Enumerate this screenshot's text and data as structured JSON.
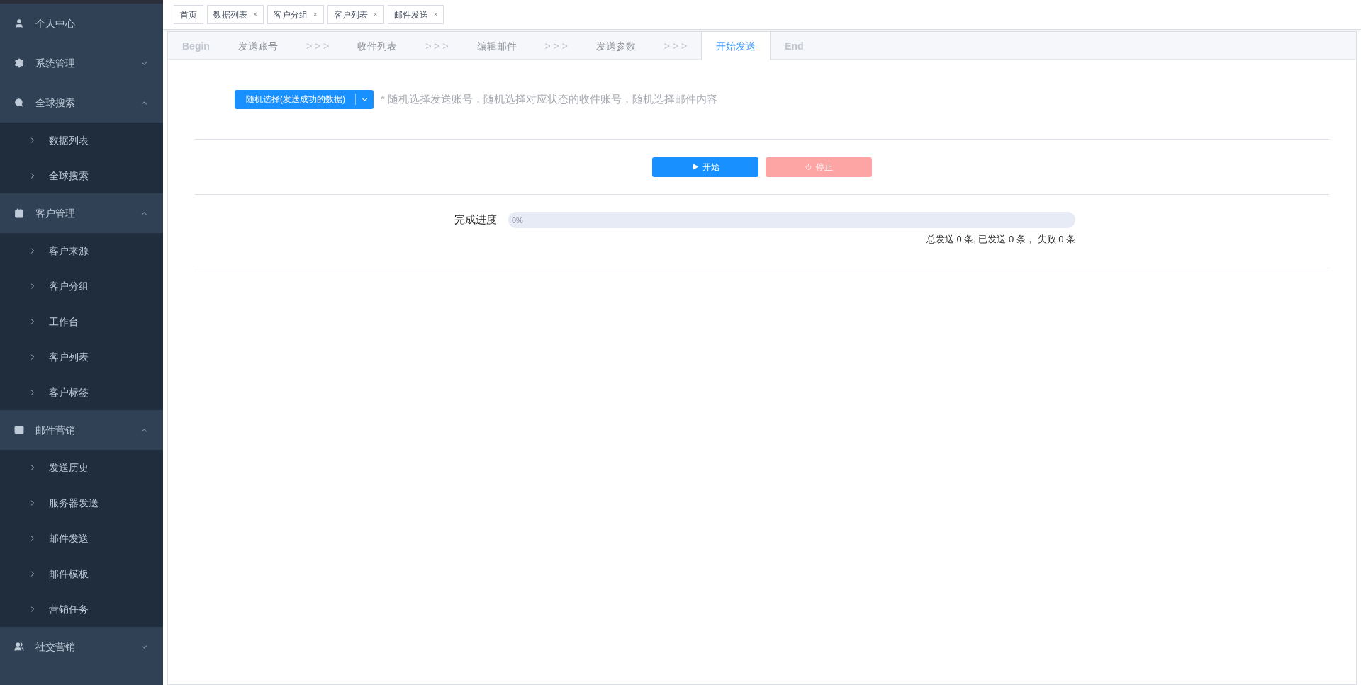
{
  "sidebar": {
    "items": [
      {
        "label": "个人中心",
        "has_children": false
      },
      {
        "label": "系统管理",
        "has_children": true,
        "expanded": false
      },
      {
        "label": "全球搜索",
        "has_children": true,
        "expanded": true,
        "children": [
          {
            "label": "数据列表"
          },
          {
            "label": "全球搜索"
          }
        ]
      },
      {
        "label": "客户管理",
        "has_children": true,
        "expanded": true,
        "children": [
          {
            "label": "客户来源"
          },
          {
            "label": "客户分组"
          },
          {
            "label": "工作台"
          },
          {
            "label": "客户列表"
          },
          {
            "label": "客户标签"
          }
        ]
      },
      {
        "label": "邮件营销",
        "has_children": true,
        "expanded": true,
        "children": [
          {
            "label": "发送历史"
          },
          {
            "label": "服务器发送"
          },
          {
            "label": "邮件发送"
          },
          {
            "label": "邮件模板"
          },
          {
            "label": "营销任务"
          }
        ]
      },
      {
        "label": "社交营销",
        "has_children": true,
        "expanded": false
      }
    ]
  },
  "tags": [
    {
      "label": "首页"
    },
    {
      "label": "数据列表",
      "close": "×"
    },
    {
      "label": "客户分组",
      "close": "×"
    },
    {
      "label": "客户列表",
      "close": "×"
    },
    {
      "label": "邮件发送",
      "close": "×"
    }
  ],
  "steps": [
    {
      "kind": "step",
      "label": "Begin",
      "selected": false,
      "disabled": true
    },
    {
      "kind": "step",
      "label": "发送账号",
      "selected": false,
      "disabled": false
    },
    {
      "kind": "separator",
      "label": "> > >"
    },
    {
      "kind": "step",
      "label": "收件列表",
      "selected": false,
      "disabled": false
    },
    {
      "kind": "separator",
      "label": "> > >"
    },
    {
      "kind": "step",
      "label": "编辑邮件",
      "selected": false,
      "disabled": false
    },
    {
      "kind": "separator",
      "label": "> > >"
    },
    {
      "kind": "step",
      "label": "发送参数",
      "selected": false,
      "disabled": false
    },
    {
      "kind": "separator",
      "label": "> > >"
    },
    {
      "kind": "step",
      "label": "开始发送",
      "selected": true,
      "disabled": false
    },
    {
      "kind": "step",
      "label": "End",
      "selected": false,
      "disabled": true
    }
  ],
  "mode": {
    "button": "随机选择(发送成功的数据)",
    "hint": "* 随机选择发送账号，随机选择对应状态的收件账号，随机选择邮件内容"
  },
  "actions": [
    {
      "kind": "start",
      "label": "开始",
      "disabled": false
    },
    {
      "kind": "stop",
      "label": "停止",
      "disabled": true
    }
  ],
  "progress": {
    "label": "完成进度",
    "level": 0,
    "reading": "0%",
    "summary": "总发送 0 条, 已发送 0 条， 失败 0 条"
  }
}
